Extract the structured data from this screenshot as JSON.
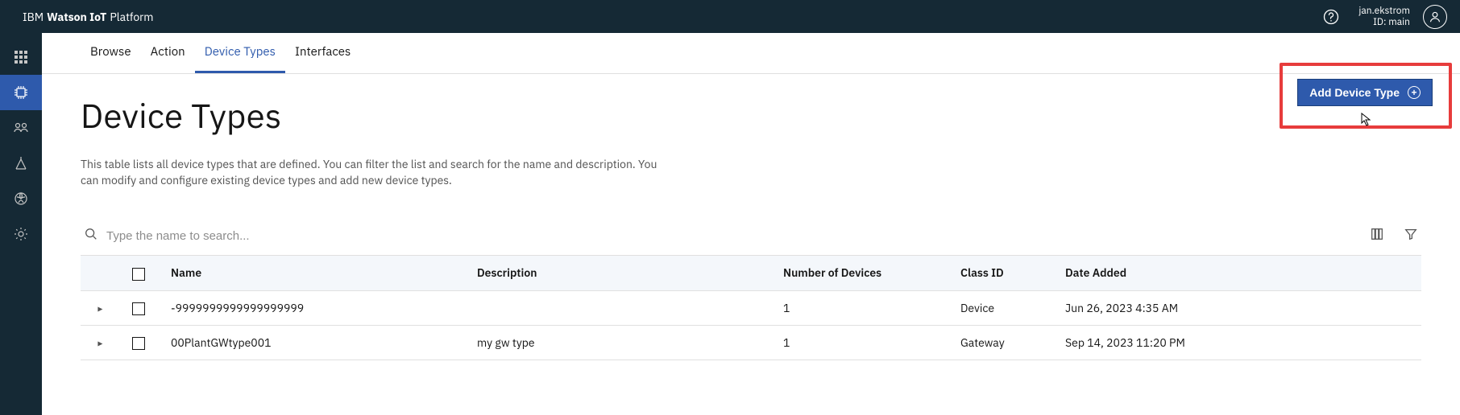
{
  "header": {
    "brand_ibm": "IBM",
    "brand_watson": "Watson IoT",
    "brand_platform": "Platform",
    "user_name": "jan.ekstrom",
    "user_id_label": "ID: main"
  },
  "tabs": [
    {
      "id": "browse",
      "label": "Browse",
      "active": false
    },
    {
      "id": "action",
      "label": "Action",
      "active": false
    },
    {
      "id": "devtyp",
      "label": "Device Types",
      "active": true
    },
    {
      "id": "ifaces",
      "label": "Interfaces",
      "active": false
    }
  ],
  "add_button": {
    "label": "Add Device Type"
  },
  "page": {
    "title": "Device Types",
    "description": "This table lists all device types that are defined. You can filter the list and search for the name and description. You can modify and configure existing device types and add new device types."
  },
  "search": {
    "placeholder": "Type the name to search..."
  },
  "table": {
    "columns": {
      "name": "Name",
      "description": "Description",
      "num_devices": "Number of Devices",
      "class_id": "Class ID",
      "date_added": "Date Added"
    },
    "rows": [
      {
        "name": "-9999999999999999999",
        "description": "",
        "num_devices": "1",
        "class_id": "Device",
        "date_added": "Jun 26, 2023 4:35 AM"
      },
      {
        "name": "00PlantGWtype001",
        "description": "my gw type",
        "num_devices": "1",
        "class_id": "Gateway",
        "date_added": "Sep 14, 2023 11:20 PM"
      }
    ]
  }
}
